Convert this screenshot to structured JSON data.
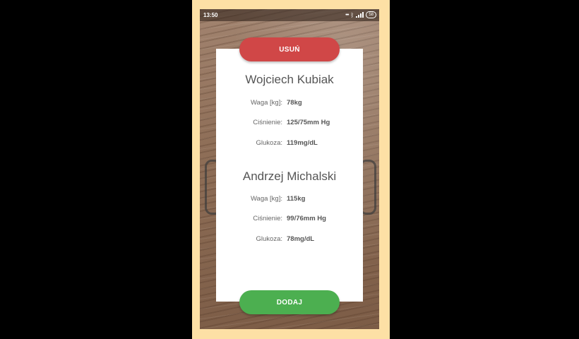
{
  "status_bar": {
    "time": "13:50",
    "battery": "58"
  },
  "actions": {
    "delete_label": "USUŃ",
    "add_label": "DODAJ"
  },
  "patients": [
    {
      "name": "Wojciech Kubiak",
      "weight_label": "Waga [kg]:",
      "weight_value": "78kg",
      "pressure_label": "Ciśnienie:",
      "pressure_value": "125/75mm Hg",
      "glucose_label": "Glukoza:",
      "glucose_value": "119mg/dL"
    },
    {
      "name": "Andrzej Michalski",
      "weight_label": "Waga [kg]:",
      "weight_value": "115kg",
      "pressure_label": "Ciśnienie:",
      "pressure_value": "99/76mm Hg",
      "glucose_label": "Glukoza:",
      "glucose_value": "78mg/dL"
    }
  ],
  "colors": {
    "delete_button": "#d04747",
    "add_button": "#4caf50",
    "card": "#ffffff",
    "frame": "#fde0a5"
  }
}
